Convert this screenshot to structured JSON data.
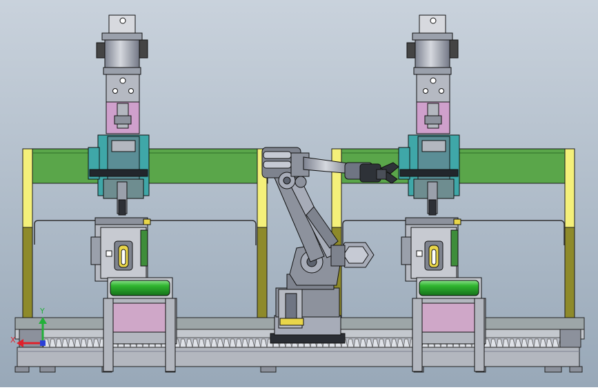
{
  "viewport": {
    "background_top": "#c9d2dc",
    "background_bottom": "#98a8b8"
  },
  "triad": {
    "x_label": "X",
    "y_label": "Y",
    "x_color": "#e0202a",
    "y_color": "#22b03a",
    "z_color": "#2a3fd8"
  },
  "colors": {
    "steel": "#a7acb8",
    "steel_dark": "#6f7583",
    "steel_light": "#c6cad4",
    "green_frame": "#5aa64a",
    "yellow_post": "#f4f07a",
    "olive_post": "#8e8a2a",
    "teal_block": "#3fa7a8",
    "pink_block": "#cfa0cc",
    "conveyor_green": "#2fb52f",
    "robot_grey": "#8d929d",
    "outline": "#1a1a1a"
  }
}
